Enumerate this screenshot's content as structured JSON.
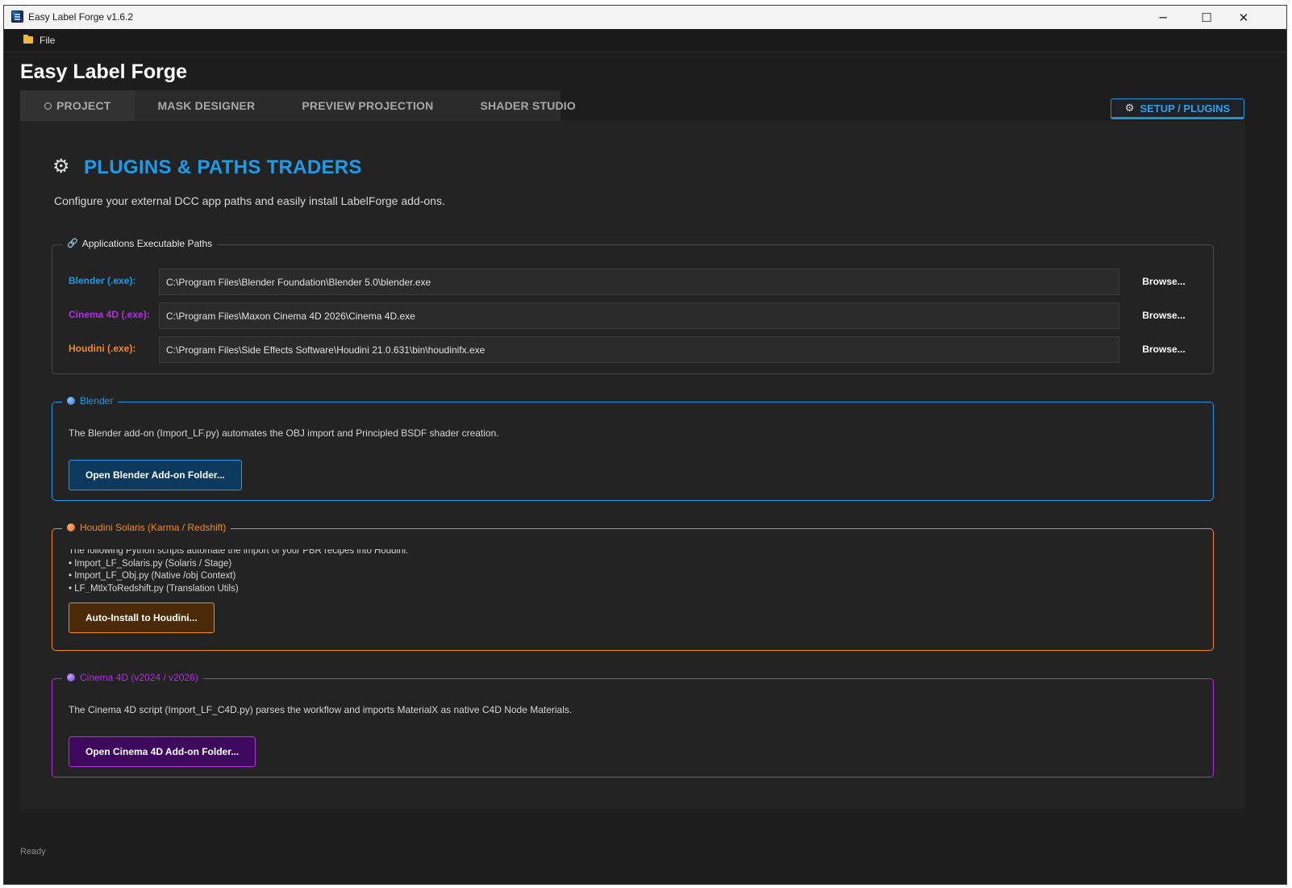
{
  "window": {
    "title": "Easy Label Forge v1.6.2",
    "controls": {
      "minimize": "─",
      "maximize": "☐",
      "close": "✕"
    }
  },
  "menu": {
    "file": "File"
  },
  "app": {
    "heading": "Easy Label Forge"
  },
  "tabs": [
    {
      "label": "PROJECT"
    },
    {
      "label": "MASK DESIGNER"
    },
    {
      "label": "PREVIEW PROJECTION"
    },
    {
      "label": "SHADER STUDIO"
    }
  ],
  "setup_tab": {
    "label": "SETUP / PLUGINS",
    "active": true
  },
  "page": {
    "title": "PLUGINS & PATHS TRADERS",
    "subtitle": "Configure your external DCC app paths and easily install LabelForge add-ons."
  },
  "paths": {
    "legend": "Applications Executable Paths",
    "rows": [
      {
        "label": "Blender (.exe):",
        "value": "C:\\Program Files\\Blender Foundation\\Blender 5.0\\blender.exe",
        "browse": "Browse...",
        "color": "#1e9be6"
      },
      {
        "label": "Cinema 4D (.exe):",
        "value": "C:\\Program Files\\Maxon Cinema 4D 2026\\Cinema 4D.exe",
        "browse": "Browse...",
        "color": "#b02ee0"
      },
      {
        "label": "Houdini (.exe):",
        "value": "C:\\Program Files\\Side Effects Software\\Houdini 21.0.631\\bin\\houdinifx.exe",
        "browse": "Browse...",
        "color": "#f08a1c"
      }
    ]
  },
  "blender": {
    "legend": "Blender",
    "description": "The Blender add-on (Import_LF.py) automates the OBJ import and Principled BSDF shader creation.",
    "button": "Open Blender Add-on Folder...",
    "color": "#1e9be6"
  },
  "houdini": {
    "legend": "Houdini Solaris (Karma / Redshift)",
    "lines": [
      "The following Python scripts automate the import of your PBR recipes into Houdini:",
      "• Import_LF_Solaris.py (Solaris / Stage)",
      "• Import_LF_Obj.py (Native /obj Context)",
      "• LF_MtlxToRedshift.py (Translation Utils)"
    ],
    "button": "Auto-Install to Houdini...",
    "color": "#f08a1c"
  },
  "cinema4d": {
    "legend": "Cinema 4D (v2024 / v2026)",
    "description": "The Cinema 4D script (Import_LF_C4D.py) parses the workflow and imports MaterialX as native C4D Node Materials.",
    "button": "Open Cinema 4D Add-on Folder...",
    "color": "#b02ee0"
  },
  "status": {
    "text": "Ready"
  }
}
